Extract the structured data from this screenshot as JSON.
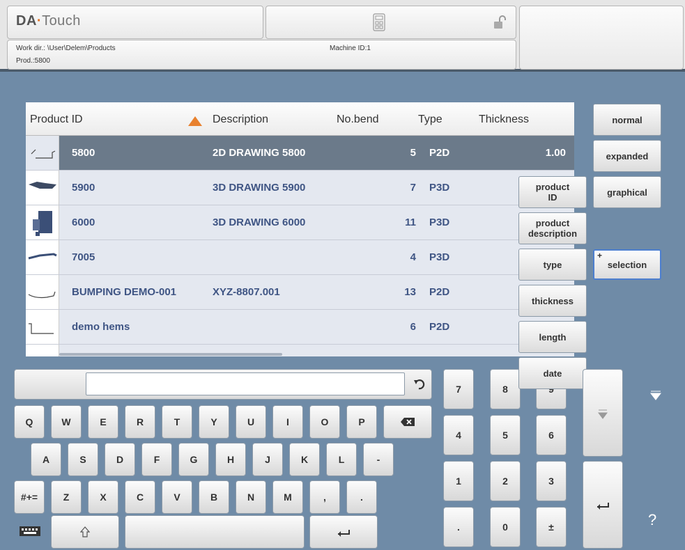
{
  "header": {
    "logo_brand": "DA",
    "logo_sep": "·",
    "logo_product": "Touch",
    "work_dir": "Work dir.: \\User\\Delem\\Products",
    "product": "Prod.:5800",
    "machine_id": "Machine ID:1",
    "icons": [
      "calculator-icon",
      "unlock-icon"
    ]
  },
  "table": {
    "columns": [
      "Product ID",
      "Description",
      "No.bend",
      "Type",
      "Thickness"
    ],
    "rows": [
      {
        "id": "5800",
        "description": "2D DRAWING 5800",
        "bends": "5",
        "type": "P2D",
        "thickness": "1.00"
      },
      {
        "id": "5900",
        "description": "3D DRAWING 5900",
        "bends": "7",
        "type": "P3D",
        "thickness": ""
      },
      {
        "id": "6000",
        "description": "3D DRAWING 6000",
        "bends": "11",
        "type": "P3D",
        "thickness": ""
      },
      {
        "id": "7005",
        "description": "",
        "bends": "4",
        "type": "P3D",
        "thickness": ""
      },
      {
        "id": "BUMPING DEMO-001",
        "description": "XYZ-8807.001",
        "bends": "13",
        "type": "P2D",
        "thickness": ""
      },
      {
        "id": "demo hems",
        "description": "",
        "bends": "6",
        "type": "P2D",
        "thickness": ""
      }
    ]
  },
  "view_buttons": {
    "normal": "normal",
    "expanded": "expanded",
    "graphical": "graphical",
    "selection": "selection",
    "selection_mark": "+"
  },
  "sort_menu": {
    "product_id_1": "product",
    "product_id_2": "ID",
    "product_desc_1": "product",
    "product_desc_2": "description",
    "type": "type",
    "thickness": "thickness",
    "length": "length",
    "date": "date"
  },
  "keyboard": {
    "row1": [
      "Q",
      "W",
      "E",
      "R",
      "T",
      "Y",
      "U",
      "I",
      "O",
      "P"
    ],
    "row2": [
      "A",
      "S",
      "D",
      "F",
      "G",
      "H",
      "J",
      "K",
      "L",
      "-"
    ],
    "row3": [
      "Z",
      "X",
      "C",
      "V",
      "B",
      "N",
      "M",
      ",",
      "."
    ],
    "symbols": "#+=",
    "input_value": ""
  },
  "numpad": {
    "row1": [
      "7",
      "8",
      "9"
    ],
    "row2": [
      "4",
      "5",
      "6"
    ],
    "row3": [
      "1",
      "2",
      "3"
    ],
    "row4": [
      ".",
      "0",
      "±"
    ]
  },
  "help": "?"
}
